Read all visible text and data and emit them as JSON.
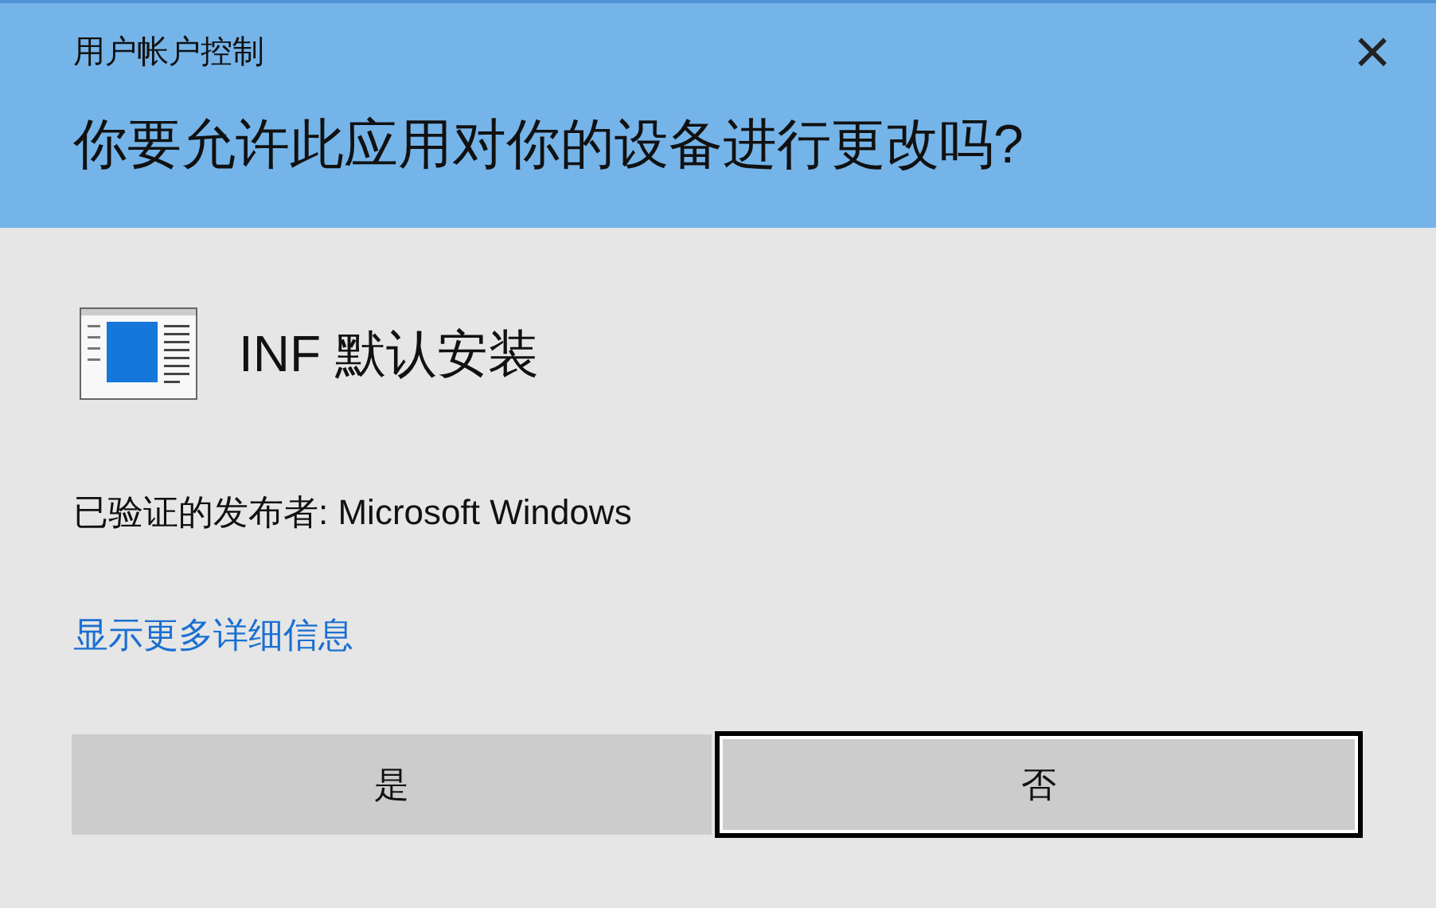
{
  "window": {
    "title": "用户帐户控制",
    "close": "×"
  },
  "question": "你要允许此应用对你的设备进行更改吗?",
  "app": {
    "name": "INF 默认安装"
  },
  "publisher": "已验证的发布者: Microsoft Windows",
  "details_link": "显示更多详细信息",
  "buttons": [
    {
      "label": "是",
      "focused": false
    },
    {
      "label": "否",
      "focused": true
    }
  ]
}
